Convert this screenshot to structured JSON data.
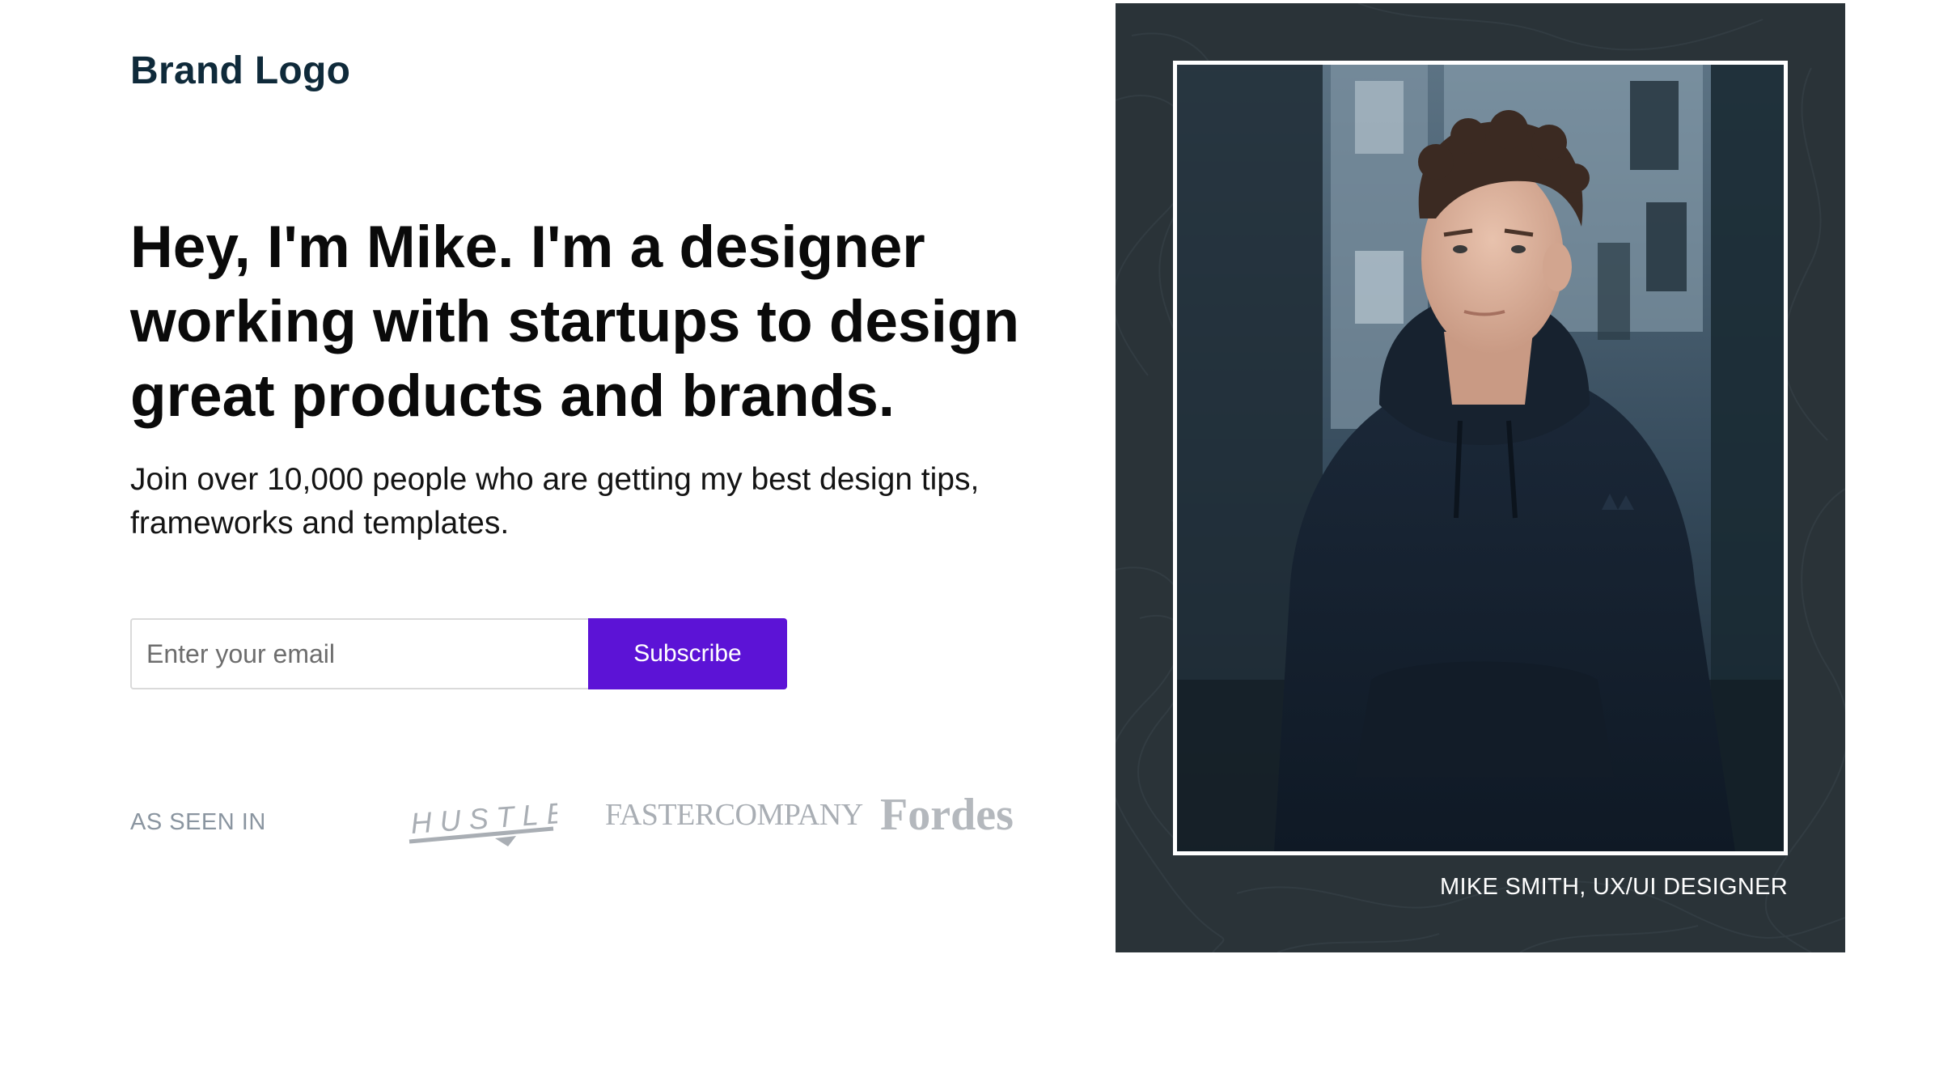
{
  "brand": {
    "logo_text": "Brand Logo"
  },
  "hero": {
    "headline": "Hey, I'm Mike. I'm a designer working with startups to design great products and brands.",
    "subtext": "Join over 10,000 people who are getting my best design tips, frameworks and templates."
  },
  "form": {
    "email_placeholder": "Enter your email",
    "subscribe_label": "Subscribe",
    "button_color": "#5c13d6"
  },
  "press": {
    "label": "AS SEEN IN",
    "logos": [
      {
        "name": "hustle-logo",
        "text": "HUSTLE"
      },
      {
        "name": "fast-company-logo",
        "text": "FASTERCOMPANY"
      },
      {
        "name": "fordes-logo",
        "text": "Fordes"
      }
    ]
  },
  "portrait": {
    "caption": "MIKE SMITH, UX/UI DESIGNER",
    "panel_color": "#2a3338"
  }
}
